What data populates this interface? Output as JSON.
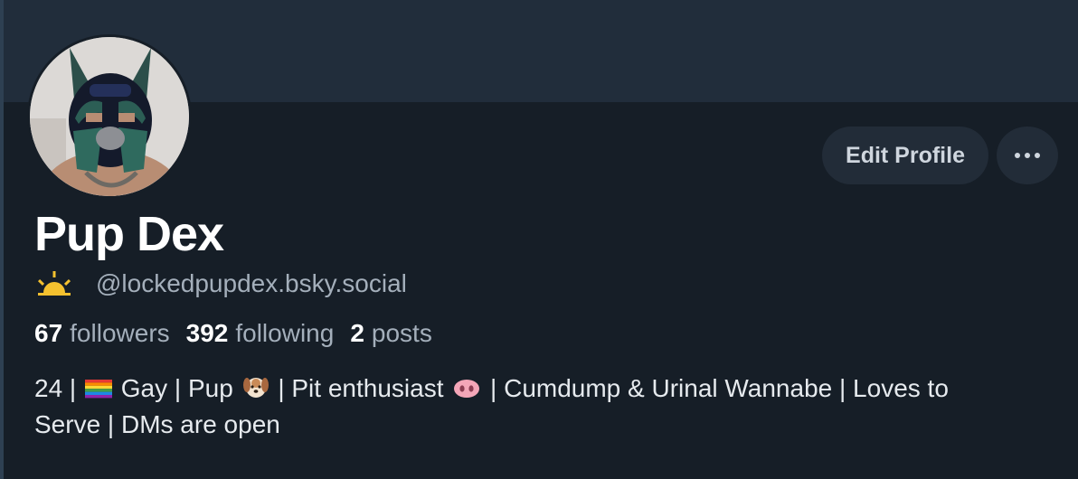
{
  "profile": {
    "display_name": "Pup Dex",
    "handle": "@lockedpupdex.bsky.social",
    "stats": {
      "followers_count": "67",
      "followers_label": "followers",
      "following_count": "392",
      "following_label": "following",
      "posts_count": "2",
      "posts_label": "posts"
    },
    "bio": {
      "line1_a": "24 | ",
      "line1_b": " Gay | Pup ",
      "line1_c": " | Pit enthusiast ",
      "line1_d": " | Cumdump & Urinal Wannabe | Loves to",
      "line2": "Serve | DMs are open"
    }
  },
  "actions": {
    "edit_profile_label": "Edit Profile",
    "more_icon": "ellipsis-icon"
  },
  "icons": {
    "handle_badge": "sunrise-icon",
    "bio_emojis": [
      "rainbow-flag-icon",
      "dog-face-icon",
      "pig-nose-icon"
    ]
  },
  "colors": {
    "page_bg": "#161e27",
    "banner_bg": "#212d3b",
    "button_bg": "#222c38",
    "muted_text": "#a4afbb"
  }
}
